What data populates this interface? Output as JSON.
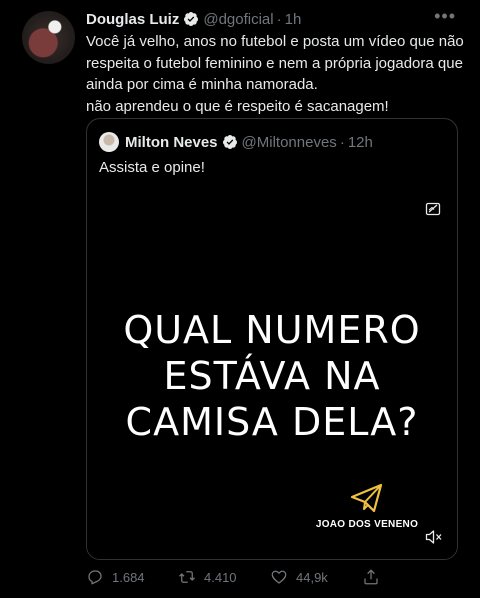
{
  "tweet": {
    "author_name": "Douglas Luiz",
    "author_handle": "@dgoficial",
    "separator": "·",
    "time": "1h",
    "more_icon": "ellipsis-icon",
    "text": "Você já velho, anos no futebol e posta um vídeo que não respeita o futebol feminino e nem a própria jogadora que ainda por cima é minha namorada.\n não aprendeu o que é respeito é sacanagem!"
  },
  "quote": {
    "author_name": "Milton Neves",
    "author_handle": "@Miltonneves",
    "separator": "·",
    "time": "12h",
    "text": "Assista e opine!",
    "media": {
      "overlay_lines": [
        "QUAL NUMERO",
        "ESTÁVA NA",
        "CAMISA DELA?"
      ],
      "logo_text": "JOAO DOS VENENO",
      "icons": [
        "media-badge-icon",
        "mute-icon"
      ]
    }
  },
  "actions": {
    "reply_count": "1.684",
    "retweet_count": "4.410",
    "like_count": "44,9k"
  },
  "colors": {
    "background": "#000000",
    "text": "#e7e9ea",
    "muted": "#71767b",
    "border": "#2f3336",
    "verified": "#e7e9ea"
  }
}
